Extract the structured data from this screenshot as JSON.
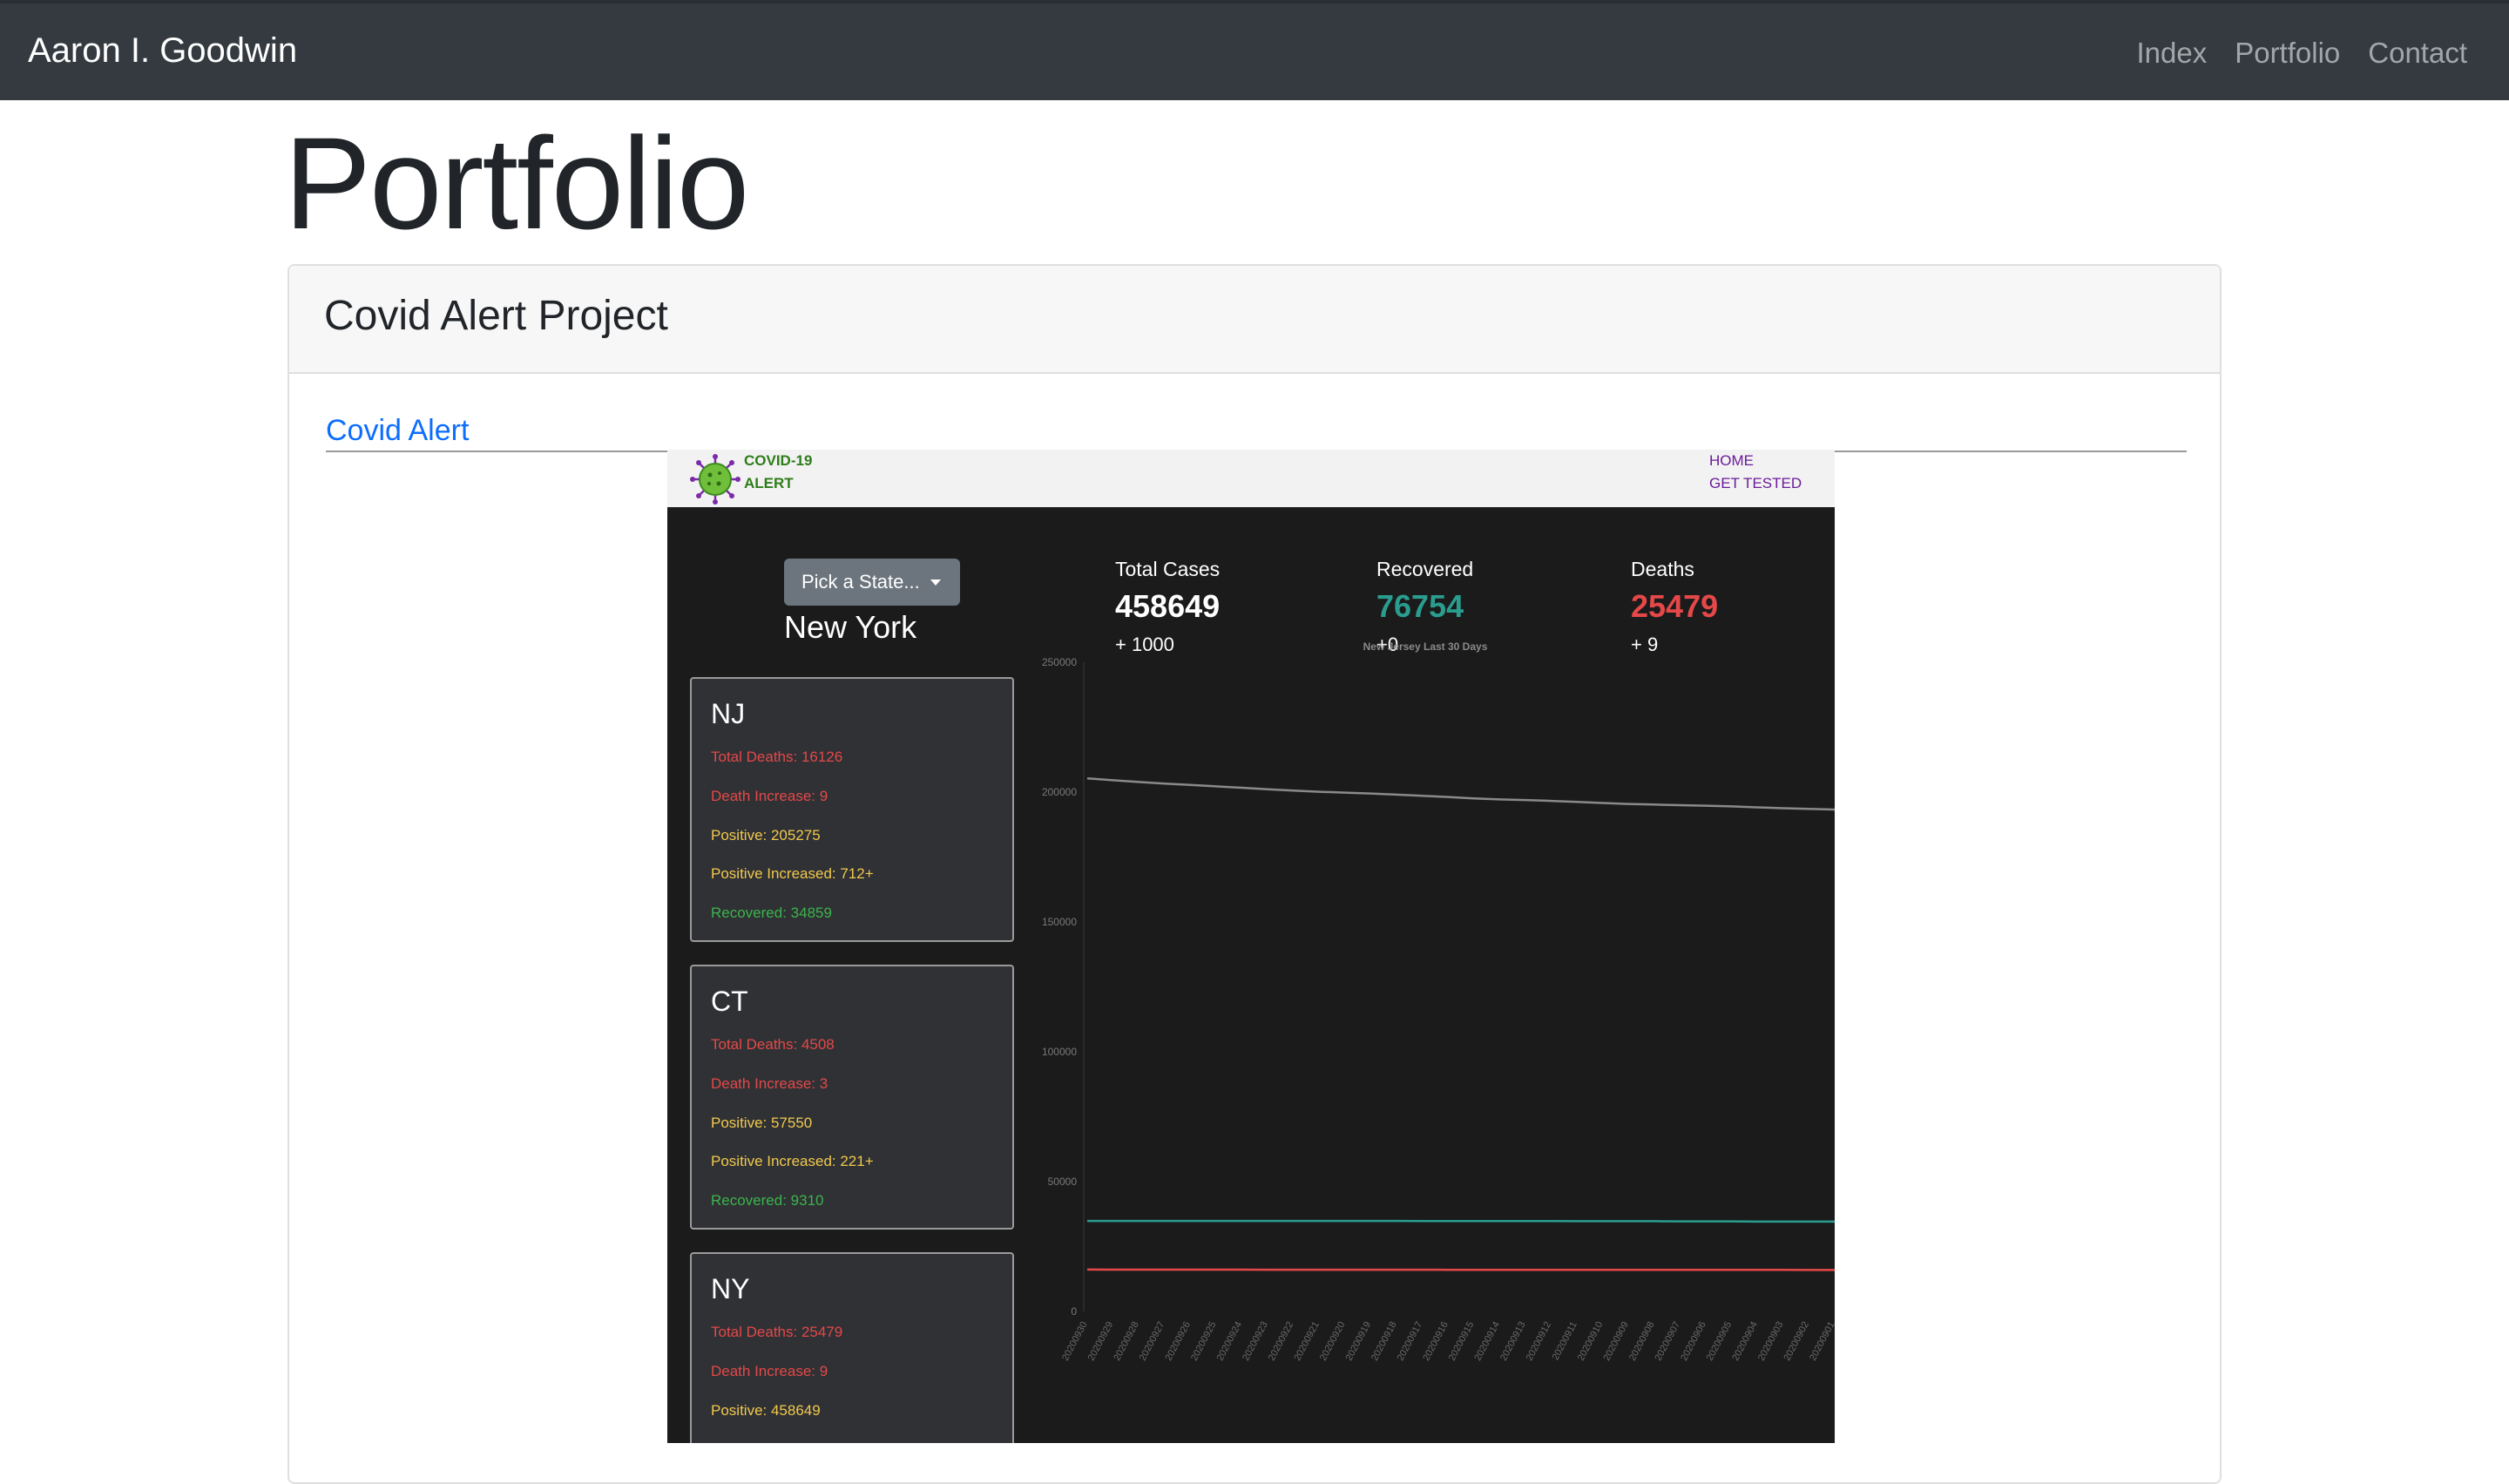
{
  "navbar": {
    "brand": "Aaron I. Goodwin",
    "links": [
      "Index",
      "Portfolio",
      "Contact"
    ]
  },
  "page": {
    "title": "Portfolio"
  },
  "card": {
    "title": "Covid Alert Project",
    "link_label": "Covid Alert"
  },
  "embed": {
    "logo_line1": "COVID-19",
    "logo_line2": "ALERT",
    "nav": [
      "HOME",
      "GET TESTED"
    ],
    "dropdown_label": "Pick a State...",
    "selected_state": "New York",
    "stats": [
      {
        "label": "Total Cases",
        "value": "458649",
        "delta": "+ 1000",
        "color": "#ffffff"
      },
      {
        "label": "Recovered",
        "value": "76754",
        "delta": "+0",
        "color": "#2a9d8f"
      },
      {
        "label": "Deaths",
        "value": "25479",
        "delta": "+ 9",
        "color": "#e54848"
      }
    ],
    "state_cards": [
      {
        "abbr": "NJ",
        "total_deaths": "Total Deaths: 16126",
        "death_increase": "Death Increase: 9",
        "positive": "Positive: 205275",
        "positive_increased": "Positive Increased: 712+",
        "recovered": "Recovered: 34859"
      },
      {
        "abbr": "CT",
        "total_deaths": "Total Deaths: 4508",
        "death_increase": "Death Increase: 3",
        "positive": "Positive: 57550",
        "positive_increased": "Positive Increased: 221+",
        "recovered": "Recovered: 9310"
      },
      {
        "abbr": "NY",
        "total_deaths": "Total Deaths: 25479",
        "death_increase": "Death Increase: 9",
        "positive": "Positive: 458649",
        "positive_increased": "",
        "recovered": ""
      }
    ]
  },
  "chart_data": {
    "type": "line",
    "title": "New Jersey Last 30 Days",
    "xlabel": "",
    "ylabel": "",
    "ylim": [
      0,
      250000
    ],
    "yticks": [
      0,
      50000,
      100000,
      150000,
      200000,
      250000
    ],
    "x": [
      "20200930",
      "20200929",
      "20200928",
      "20200927",
      "20200926",
      "20200925",
      "20200924",
      "20200923",
      "20200922",
      "20200921",
      "20200920",
      "20200919",
      "20200918",
      "20200917",
      "20200916",
      "20200915",
      "20200914",
      "20200913",
      "20200912",
      "20200911",
      "20200910",
      "20200909",
      "20200908",
      "20200907",
      "20200906",
      "20200905",
      "20200904",
      "20200903",
      "20200902",
      "20200901"
    ],
    "grid": false,
    "legend": "none",
    "series": [
      {
        "color": "#8a8a8a",
        "values": [
          205275,
          204563,
          203908,
          203297,
          202756,
          202208,
          201684,
          201101,
          200571,
          200147,
          199798,
          199459,
          199029,
          198569,
          198108,
          197563,
          197190,
          196933,
          196621,
          196220,
          195811,
          195446,
          195212,
          194980,
          194756,
          194480,
          194134,
          193796,
          193529,
          193273
        ]
      },
      {
        "color": "#2a9d8f",
        "values": [
          34859,
          34859,
          34859,
          34859,
          34859,
          34859,
          34859,
          34855,
          34855,
          34855,
          34855,
          34855,
          34855,
          34800,
          34800,
          34800,
          34800,
          34800,
          34800,
          34750,
          34750,
          34750,
          34750,
          34700,
          34700,
          34700,
          34600,
          34600,
          34600,
          34600
        ]
      },
      {
        "color": "#e54848",
        "values": [
          16126,
          16117,
          16115,
          16112,
          16104,
          16100,
          16092,
          16087,
          16083,
          16076,
          16074,
          16072,
          16069,
          16060,
          16052,
          16047,
          16045,
          16040,
          16033,
          16030,
          16027,
          16019,
          16013,
          16011,
          16006,
          16001,
          15997,
          15992,
          15985,
          15976
        ]
      }
    ]
  }
}
